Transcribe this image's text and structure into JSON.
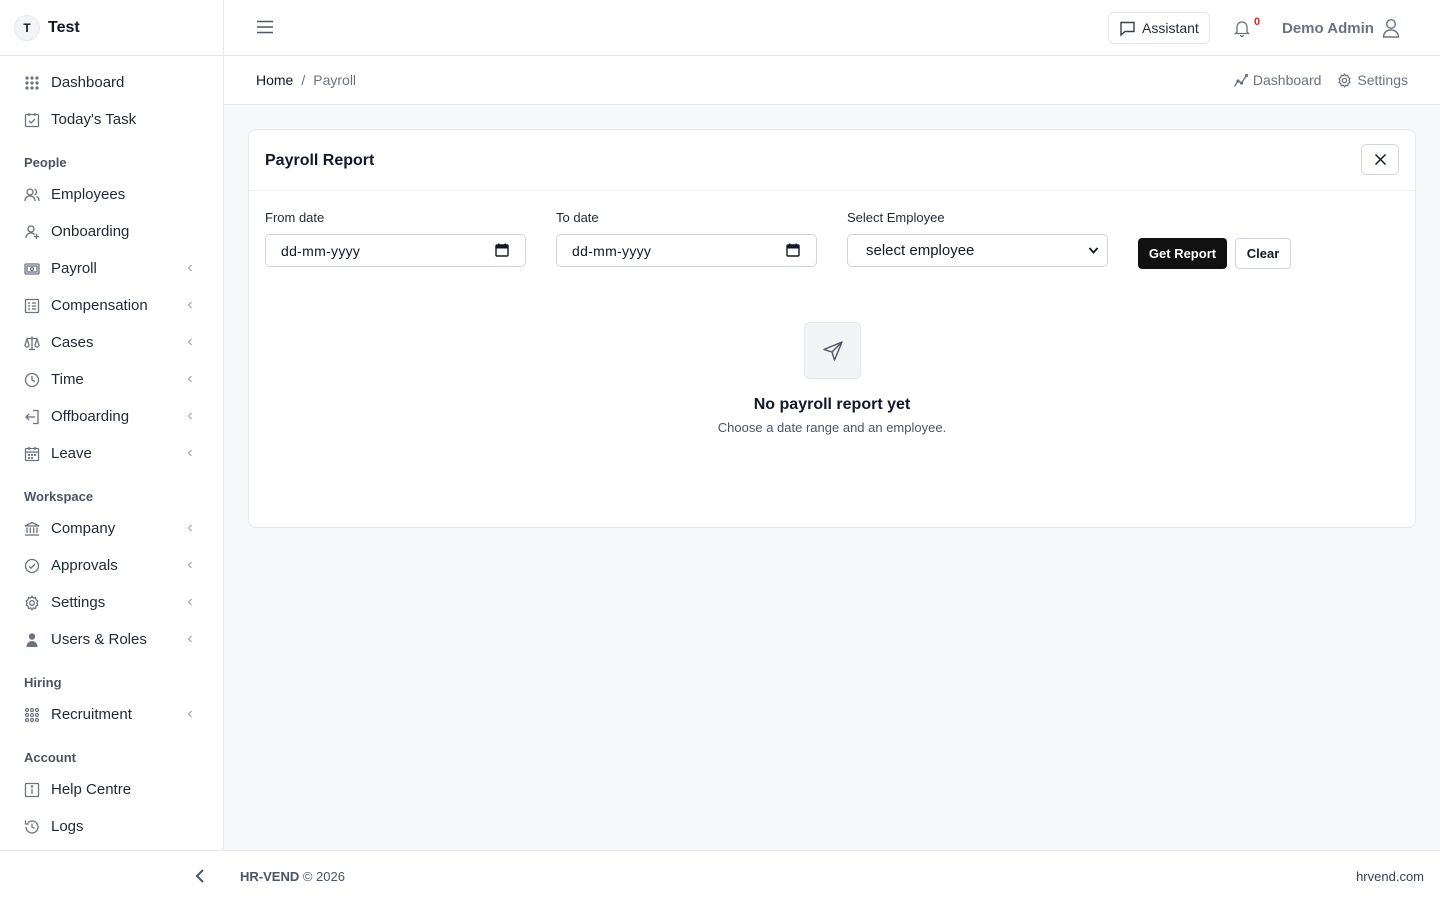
{
  "brand": {
    "initial": "T",
    "name": "Test"
  },
  "sidebar": {
    "top_items": [
      {
        "label": "Dashboard",
        "icon": "grid-dots-icon"
      },
      {
        "label": "Today's Task",
        "icon": "calendar-check-icon"
      }
    ],
    "sections": {
      "people": "People",
      "workspace": "Workspace",
      "hiring": "Hiring",
      "account": "Account"
    },
    "people_items": [
      {
        "label": "Employees",
        "icon": "users-icon"
      },
      {
        "label": "Onboarding",
        "icon": "user-plus-icon"
      },
      {
        "label": "Payroll",
        "icon": "money-icon"
      },
      {
        "label": "Compensation",
        "icon": "list-icon"
      },
      {
        "label": "Cases",
        "icon": "scale-icon"
      },
      {
        "label": "Time",
        "icon": "clock-icon"
      },
      {
        "label": "Offboarding",
        "icon": "logout-icon"
      },
      {
        "label": "Leave",
        "icon": "calendar-icon"
      }
    ],
    "workspace_items": [
      {
        "label": "Company",
        "icon": "bank-icon"
      },
      {
        "label": "Approvals",
        "icon": "check-circle-icon"
      },
      {
        "label": "Settings",
        "icon": "gear-icon"
      },
      {
        "label": "Users & Roles",
        "icon": "user-shield-icon"
      }
    ],
    "hiring_items": [
      {
        "label": "Recruitment",
        "icon": "grid-dots-icon"
      }
    ],
    "account_items": [
      {
        "label": "Help Centre",
        "icon": "info-icon"
      },
      {
        "label": "Logs",
        "icon": "history-icon"
      }
    ]
  },
  "topbar": {
    "assistant_label": "Assistant",
    "notification_count": "0",
    "user_name": "Demo Admin"
  },
  "breadcrumb": {
    "home": "Home",
    "separator": "/",
    "current": "Payroll"
  },
  "quicklinks": {
    "dashboard": "Dashboard",
    "settings": "Settings"
  },
  "report": {
    "title": "Payroll Report",
    "from_label": "From date",
    "from_placeholder": "dd-mm-yyyy",
    "to_label": "To date",
    "to_placeholder": "dd-mm-yyyy",
    "employee_label": "Select Employee",
    "employee_value": "select employee",
    "get_report": "Get Report",
    "clear": "Clear",
    "empty_title": "No payroll report yet",
    "empty_subtitle": "Choose a date range and an employee."
  },
  "footer": {
    "brand": "HR-VEND",
    "copyright": "© 2026",
    "site": "hrvend.com"
  }
}
